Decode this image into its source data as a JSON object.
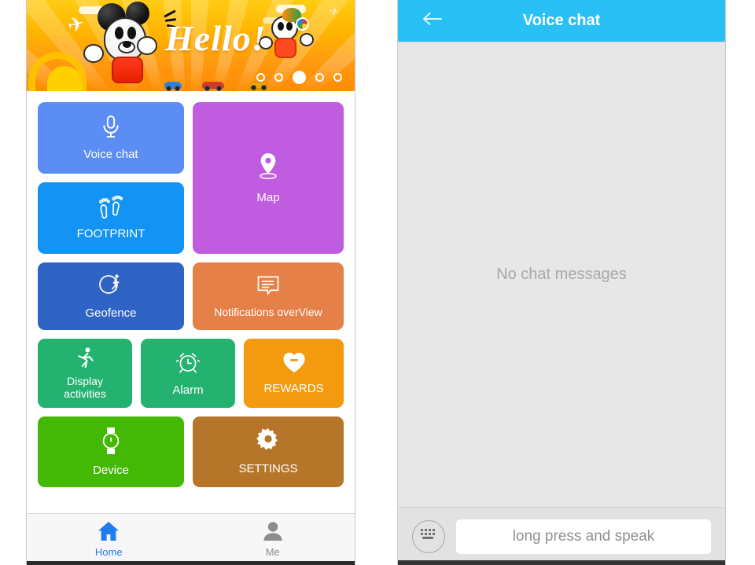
{
  "home_screen": {
    "banner": {
      "greeting": "Hello!",
      "dot_count": 5,
      "active_dot_index": 2
    },
    "tiles": [
      {
        "id": "voice-chat",
        "label": "Voice chat",
        "icon": "microphone-icon",
        "color": "#5b8df5"
      },
      {
        "id": "footprint",
        "label": "FOOTPRINT",
        "icon": "footprints-icon",
        "color": "#1394f5"
      },
      {
        "id": "map",
        "label": "Map",
        "icon": "map-pin-icon",
        "color": "#c05ce0"
      },
      {
        "id": "geofence",
        "label": "Geofence",
        "icon": "geofence-icon",
        "color": "#2f63c4"
      },
      {
        "id": "notifications",
        "label": "Notifications overView",
        "icon": "message-icon",
        "color": "#e58048"
      },
      {
        "id": "display-activities",
        "label": "Display\nactivities",
        "icon": "runner-icon",
        "color": "#24b271"
      },
      {
        "id": "alarm",
        "label": "Alarm",
        "icon": "alarm-clock-icon",
        "color": "#24b271"
      },
      {
        "id": "rewards",
        "label": "REWARDS",
        "icon": "heart-icon",
        "color": "#f39a0e"
      },
      {
        "id": "device",
        "label": "Device",
        "icon": "watch-icon",
        "color": "#44b905"
      },
      {
        "id": "settings",
        "label": "SETTINGS",
        "icon": "gear-icon",
        "color": "#b5762a"
      }
    ],
    "tile_labels": {
      "voice_chat": "Voice chat",
      "footprint": "FOOTPRINT",
      "map": "Map",
      "geofence": "Geofence",
      "notifications": "Notifications overView",
      "display_activities_line1": "Display",
      "display_activities_line2": "activities",
      "alarm": "Alarm",
      "rewards": "REWARDS",
      "device": "Device",
      "settings": "SETTINGS"
    },
    "tabbar": {
      "tabs": [
        {
          "label": "Home",
          "icon": "home-icon",
          "active": true,
          "color": "#1e7bf0"
        },
        {
          "label": "Me",
          "icon": "person-icon",
          "active": false,
          "color": "#8c8c8c"
        }
      ],
      "home_label": "Home",
      "me_label": "Me"
    }
  },
  "voice_chat_screen": {
    "navbar": {
      "back_icon": "arrow-left-icon",
      "title": "Voice chat",
      "background": "#29c1f5"
    },
    "body": {
      "empty_state": "No chat messages"
    },
    "composer": {
      "keyboard_icon": "keyboard-icon",
      "speak_button_label": "long press and speak"
    }
  }
}
